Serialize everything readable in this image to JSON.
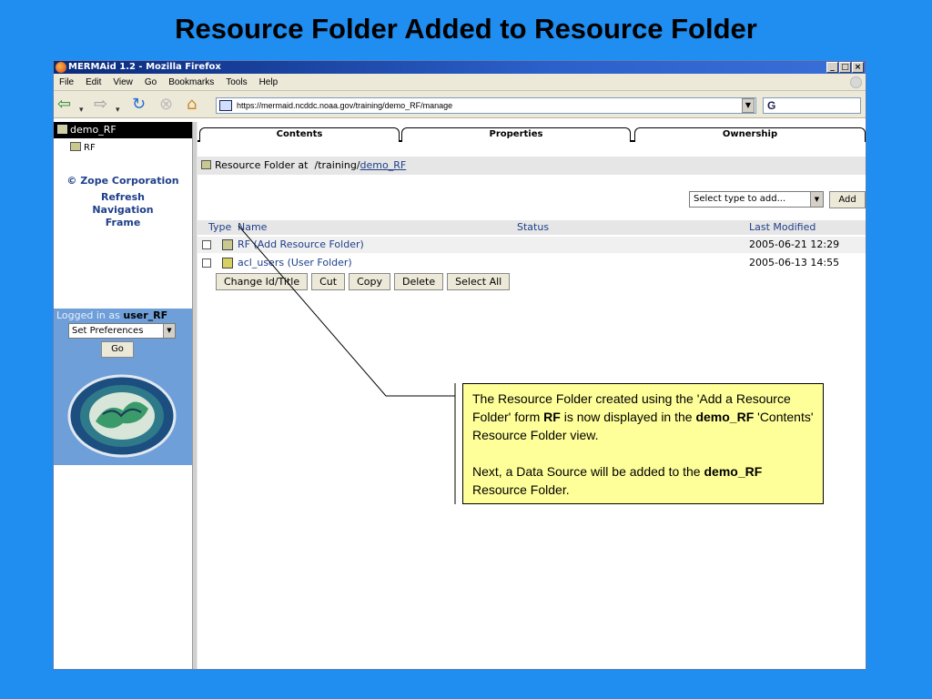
{
  "slide": {
    "title": "Resource Folder Added to Resource Folder"
  },
  "browser": {
    "window_title": "MERMAid 1.2 - Mozilla Firefox",
    "window_buttons": [
      "_",
      "□",
      "×"
    ],
    "menu": [
      "File",
      "Edit",
      "View",
      "Go",
      "Bookmarks",
      "Tools",
      "Help"
    ],
    "url": "https://mermaid.ncddc.noaa.gov/training/demo_RF/manage",
    "search_value": "G"
  },
  "left_frame": {
    "root_label": "demo_RF",
    "child_label": "RF",
    "copyright": "© Zope Corporation",
    "refresh": "Refresh",
    "navigation": "Navigation",
    "frame": "Frame",
    "logged_in_prefix": "Logged in as",
    "username": "user_RF",
    "preferences_value": "Set Preferences",
    "go_label": "Go"
  },
  "tabs": {
    "contents": "Contents",
    "properties": "Properties",
    "ownership": "Ownership"
  },
  "location": {
    "prefix": "Resource Folder at",
    "path": "/training/",
    "current": "demo_RF"
  },
  "add": {
    "select_value": "Select type to add...",
    "button": "Add"
  },
  "table": {
    "headers": {
      "type": "Type",
      "name": "Name",
      "status": "Status",
      "modified": "Last Modified"
    },
    "rows": [
      {
        "name": "RF (Add Resource Folder)",
        "modified": "2005-06-21 12:29"
      },
      {
        "name": "acl_users (User Folder)",
        "modified": "2005-06-13 14:55"
      }
    ]
  },
  "actions": [
    "Change Id/Title",
    "Cut",
    "Copy",
    "Delete",
    "Select All"
  ],
  "callout": {
    "p1_a": "The Resource Folder created using the 'Add a Resource Folder' form ",
    "p1_b": "RF",
    "p1_c": " is now displayed in the ",
    "p1_d": "demo_RF",
    "p1_e": " 'Contents' Resource Folder view.",
    "p2_a": "Next, a Data Source will be added to the ",
    "p2_b": "demo_RF",
    "p2_c": " Resource Folder."
  },
  "colors": {
    "slide_bg": "#1f8ef0",
    "callout_bg": "#ffff99",
    "link": "#1e3f8a",
    "login_panel": "#6f9fd8"
  }
}
